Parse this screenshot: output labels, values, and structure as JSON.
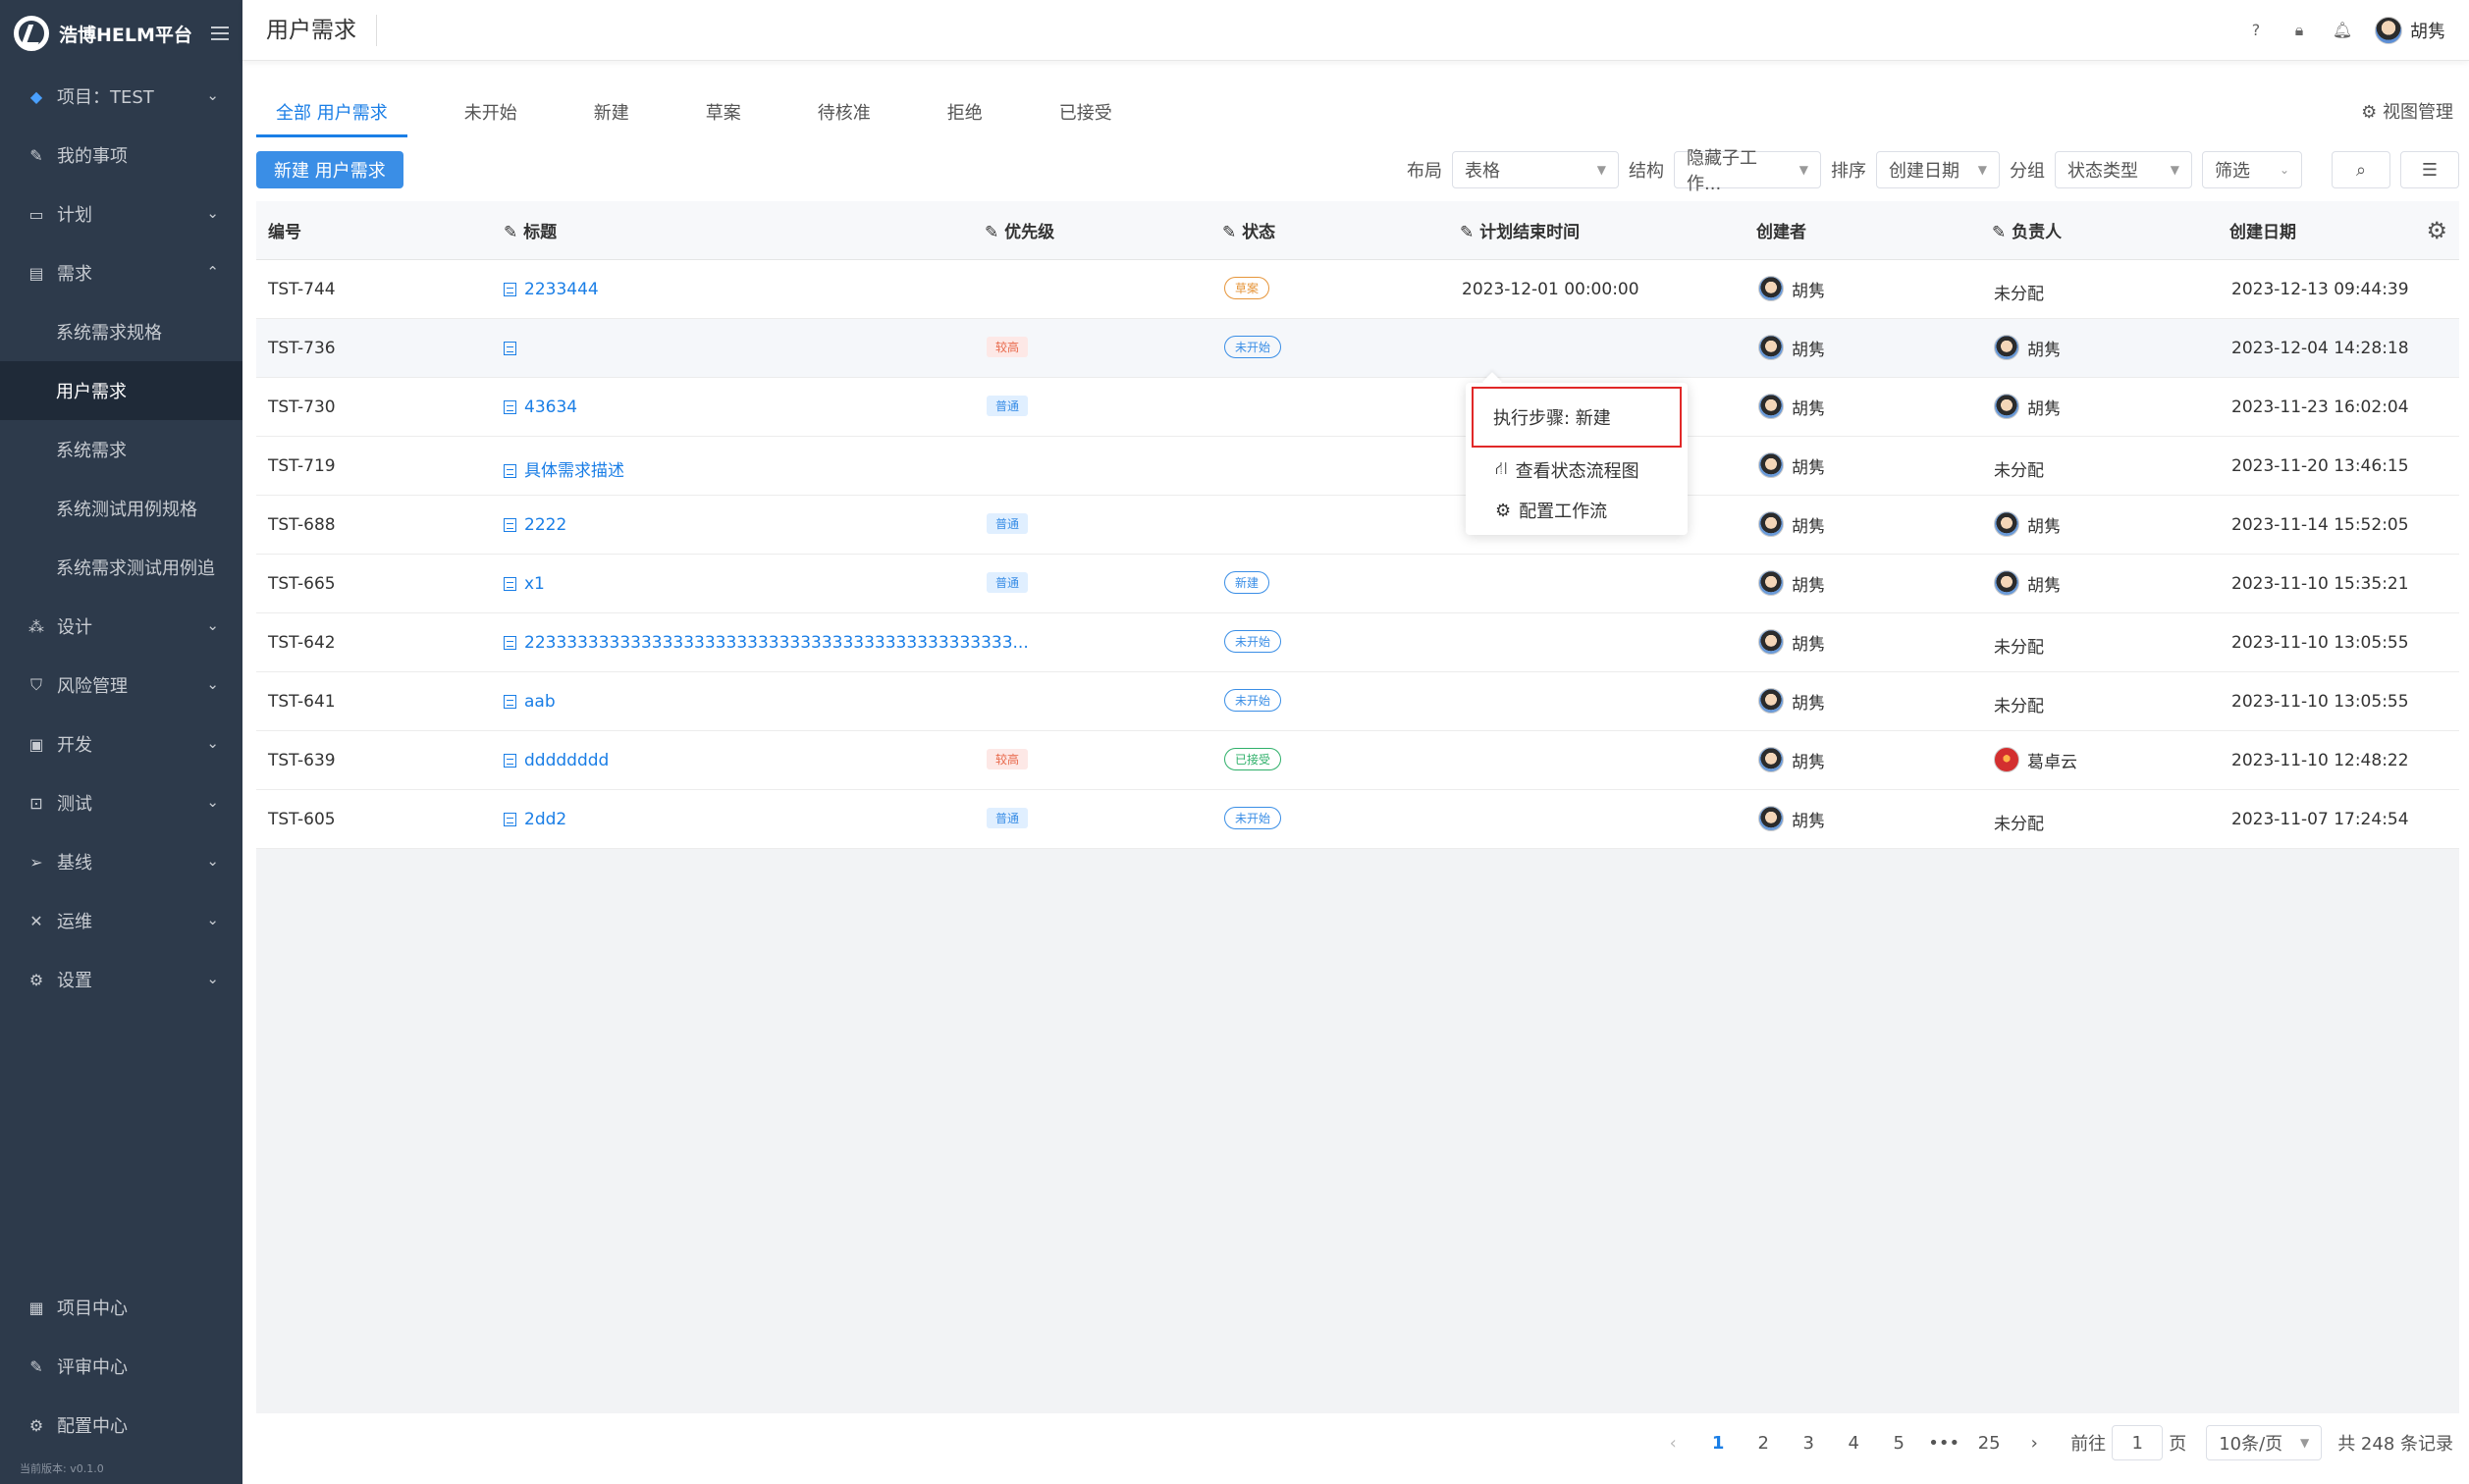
{
  "app": {
    "name": "浩博HELM平台",
    "version": "当前版本: v0.1.0"
  },
  "sidebar": {
    "project": "项目：TEST",
    "items": [
      {
        "label": "我的事项",
        "icon": "edit-icon"
      },
      {
        "label": "计划",
        "icon": "calendar-icon"
      },
      {
        "label": "需求",
        "icon": "list-icon"
      },
      {
        "label": "设计",
        "icon": "design-icon"
      },
      {
        "label": "风险管理",
        "icon": "shield-icon"
      },
      {
        "label": "开发",
        "icon": "code-icon"
      },
      {
        "label": "测试",
        "icon": "test-icon"
      },
      {
        "label": "基线",
        "icon": "send-icon"
      },
      {
        "label": "运维",
        "icon": "tools-icon"
      },
      {
        "label": "设置",
        "icon": "gear-icon"
      }
    ],
    "sub_items": [
      "系统需求规格",
      "用户需求",
      "系统需求",
      "系统测试用例规格",
      "系统需求测试用例追"
    ],
    "bottom": [
      "项目中心",
      "评审中心",
      "配置中心"
    ]
  },
  "header": {
    "title": "用户需求",
    "user": "胡隽"
  },
  "tabs": [
    "全部 用户需求",
    "未开始",
    "新建",
    "草案",
    "待核准",
    "拒绝",
    "已接受"
  ],
  "view_manage": "视图管理",
  "toolbar": {
    "new_button": "新建 用户需求",
    "layout_label": "布局",
    "layout_value": "表格",
    "structure_label": "结构",
    "structure_value": "隐藏子工作...",
    "sort_label": "排序",
    "sort_value": "创建日期",
    "group_label": "分组",
    "group_value": "状态类型",
    "filter_label": "筛选"
  },
  "table": {
    "headers": [
      "编号",
      "标题",
      "优先级",
      "状态",
      "计划结束时间",
      "创建者",
      "负责人",
      "创建日期"
    ],
    "rows": [
      {
        "id": "TST-744",
        "title": "2233444",
        "priority": "",
        "status": "草案",
        "end": "2023-12-01 00:00:00",
        "creator": "胡隽",
        "owner": "未分配",
        "created": "2023-12-13 09:44:39"
      },
      {
        "id": "TST-736",
        "title": "",
        "priority": "较高",
        "status": "未开始",
        "end": "",
        "creator": "胡隽",
        "owner": "胡隽",
        "created": "2023-12-04 14:28:18"
      },
      {
        "id": "TST-730",
        "title": "43634",
        "priority": "普通",
        "status": "",
        "end": "",
        "creator": "胡隽",
        "owner": "胡隽",
        "created": "2023-11-23 16:02:04"
      },
      {
        "id": "TST-719",
        "title": "具体需求描述",
        "priority": "",
        "status": "",
        "end": "",
        "creator": "胡隽",
        "owner": "未分配",
        "created": "2023-11-20 13:46:15"
      },
      {
        "id": "TST-688",
        "title": "2222",
        "priority": "普通",
        "status": "",
        "end": "",
        "creator": "胡隽",
        "owner": "胡隽",
        "created": "2023-11-14 15:52:05"
      },
      {
        "id": "TST-665",
        "title": "x1",
        "priority": "普通",
        "status": "新建",
        "end": "",
        "creator": "胡隽",
        "owner": "胡隽",
        "created": "2023-11-10 15:35:21"
      },
      {
        "id": "TST-642",
        "title": "2233333333333333333333333333333333333333333333...",
        "priority": "",
        "status": "未开始",
        "end": "",
        "creator": "胡隽",
        "owner": "未分配",
        "created": "2023-11-10 13:05:55"
      },
      {
        "id": "TST-641",
        "title": "aab",
        "priority": "",
        "status": "未开始",
        "end": "",
        "creator": "胡隽",
        "owner": "未分配",
        "created": "2023-11-10 13:05:55"
      },
      {
        "id": "TST-639",
        "title": "dddddddd",
        "priority": "较高",
        "status": "已接受",
        "end": "",
        "creator": "胡隽",
        "owner": "葛卓云",
        "created": "2023-11-10 12:48:22"
      },
      {
        "id": "TST-605",
        "title": "2dd2",
        "priority": "普通",
        "status": "未开始",
        "end": "",
        "creator": "胡隽",
        "owner": "未分配",
        "created": "2023-11-07 17:24:54"
      }
    ]
  },
  "popup": {
    "step": "执行步骤:   新建",
    "flow": "查看状态流程图",
    "config": "配置工作流"
  },
  "pager": {
    "pages": [
      "1",
      "2",
      "3",
      "4",
      "5",
      "•••",
      "25"
    ],
    "goto": "前往",
    "page_input": "1",
    "page_unit": "页",
    "page_size": "10条/页",
    "total": "共 248 条记录"
  }
}
